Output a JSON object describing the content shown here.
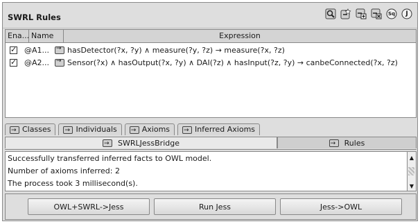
{
  "header": {
    "title": "SWRL Rules",
    "toolbar_icons": [
      "find-icon",
      "new-rule-icon",
      "add-rule-icon",
      "delete-rule-icon",
      "sq-icon",
      "j-icon"
    ],
    "sq_label": "Sq",
    "j_label": "J"
  },
  "table": {
    "columns": [
      "Ena...",
      "Name",
      "Expression"
    ],
    "rows": [
      {
        "enabled": true,
        "name": "@A1...",
        "expression": "hasDetector(?x, ?y) ∧ measure(?y, ?z) → measure(?x, ?z)"
      },
      {
        "enabled": true,
        "name": "@A2...",
        "expression": "Sensor(?x) ∧ hasOutput(?x, ?y) ∧ DAI(?z) ∧ hasInput(?z, ?y) → canbeConnected(?x, ?z)"
      }
    ]
  },
  "tabs": [
    "Classes",
    "Individuals",
    "Axioms",
    "Inferred Axioms"
  ],
  "subtabs": {
    "active": "SWRLJessBridge",
    "inactive": "Rules"
  },
  "output": {
    "lines": [
      "Successfully transferred inferred facts to OWL model.",
      "Number of axioms inferred: 2",
      "The process took 3 millisecond(s)."
    ]
  },
  "buttons": {
    "owl_to_jess": "OWL+SWRL->Jess",
    "run_jess": "Run Jess",
    "jess_to_owl": "Jess->OWL"
  },
  "colors": {
    "background": "#dedede",
    "panel_border": "#8a8a8a",
    "active_tab": "#e9e9e9"
  }
}
